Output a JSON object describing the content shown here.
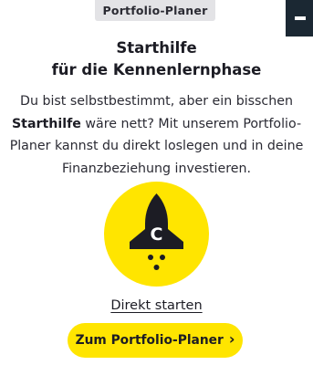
{
  "header": {
    "badge_label": "Portfolio-Planer",
    "menu_icon": "hamburger-menu-icon"
  },
  "hero": {
    "title_line1": "Starthilfe",
    "title_line2": "für die Kennenlernphase",
    "intro_before": "Du bist selbstbestimmt, aber ein bisschen ",
    "intro_bold": "Starthilfe",
    "intro_after": " wäre nett? Mit unserem Portfolio-Planer kannst du direkt loslegen und in deine Finanzbeziehung investieren.",
    "illustration_icon": "rocket-icon",
    "illustration_letter": "C"
  },
  "actions": {
    "link_label": "Direkt starten",
    "cta_label": "Zum Portfolio-Planer",
    "cta_icon": "chevron-right-icon",
    "cta_chevron": "›"
  },
  "colors": {
    "accent": "#ffe500",
    "dark": "#1c1c24",
    "menu_bg": "#1b2833",
    "badge_bg": "#e3e3e6"
  }
}
